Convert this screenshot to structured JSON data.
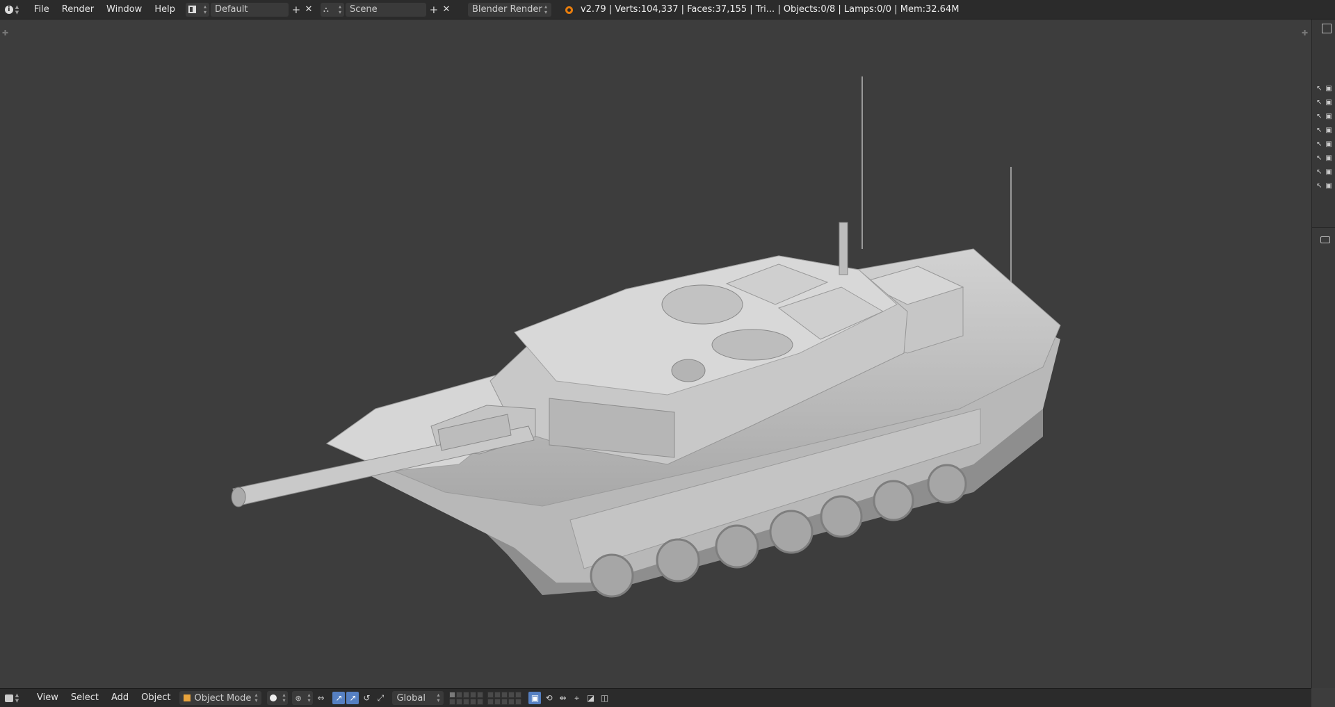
{
  "topbar": {
    "menus": [
      "File",
      "Render",
      "Window",
      "Help"
    ],
    "screen_layout": "Default",
    "scene": "Scene",
    "render_engine": "Blender Render",
    "stats": "v2.79 | Verts:104,337 | Faces:37,155 | Tri... | Objects:0/8 | Lamps:0/0 | Mem:32.64M"
  },
  "bottombar": {
    "menus": [
      "View",
      "Select",
      "Add",
      "Object"
    ],
    "mode": "Object Mode",
    "orientation": "Global"
  },
  "colors": {
    "viewport_bg": "#3d3d3d",
    "header_bg": "#2b2b2b",
    "accent": "#5680c2",
    "model": "#c9c9c9"
  },
  "icons": {
    "info": "info-icon",
    "layout": "screen-layout-icon",
    "scene": "scene-icon",
    "blender": "blender-logo-icon",
    "add": "plus-icon",
    "close": "close-icon"
  },
  "outliner_rows": 8
}
